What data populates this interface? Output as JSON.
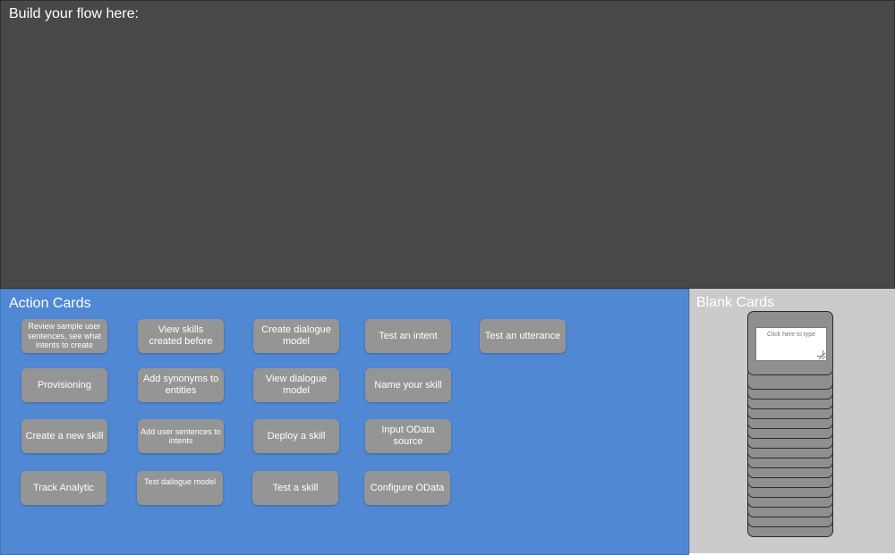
{
  "canvas": {
    "title": "Build your flow here:"
  },
  "action_cards": {
    "title": "Action Cards",
    "cards": [
      "Review sample user sentences, see what intents to create",
      "View skills created before",
      "Create dialogue model",
      "Test an intent",
      "Test an utterance",
      "Provisioning",
      "Add synonyms to entities",
      "View dialogue model",
      "Name your skill",
      "Create a new skill",
      "Add user sentences to intents",
      "Deploy a skill",
      "Input OData source",
      "Track Analytic",
      "Test dailogue model",
      "Test a skill",
      "Configure OData"
    ]
  },
  "blank_cards": {
    "title": "Blank Cards",
    "input_placeholder": "Click here to type"
  }
}
